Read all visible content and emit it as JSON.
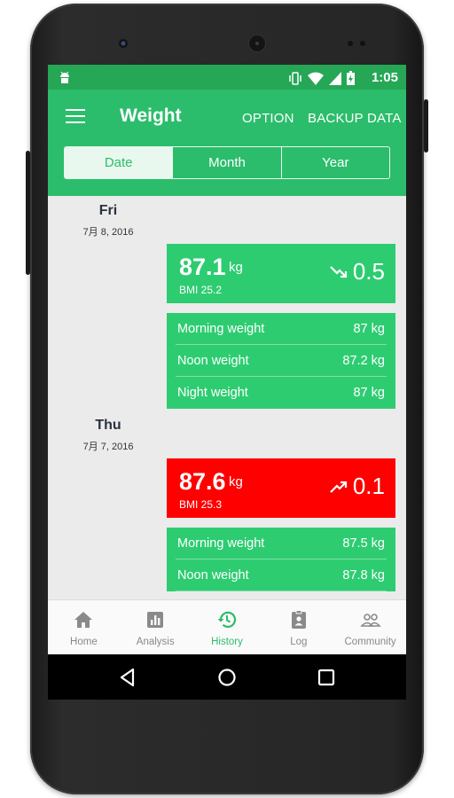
{
  "status_bar": {
    "time": "1:05"
  },
  "app_bar": {
    "title": "Weight",
    "option_label": "OPTION",
    "backup_label": "BACKUP DATA",
    "segments": [
      {
        "label": "Date",
        "active": true
      },
      {
        "label": "Month",
        "active": false
      },
      {
        "label": "Year",
        "active": false
      }
    ]
  },
  "days": [
    {
      "day": "Fri",
      "date": "7月 8, 2016",
      "weight": "87.1",
      "unit": "kg",
      "bmi": "BMI 25.2",
      "trend_icon": "trending-down-icon",
      "change": "0.5",
      "status_color": "#2ecc71",
      "readings": [
        {
          "label": "Morning weight",
          "value": "87 kg"
        },
        {
          "label": "Noon weight",
          "value": "87.2 kg"
        },
        {
          "label": "Night weight",
          "value": "87 kg"
        }
      ]
    },
    {
      "day": "Thu",
      "date": "7月 7, 2016",
      "weight": "87.6",
      "unit": "kg",
      "bmi": "BMI 25.3",
      "trend_icon": "trending-up-icon",
      "change": "0.1",
      "status_color": "#ff0000",
      "readings": [
        {
          "label": "Morning weight",
          "value": "87.5 kg"
        },
        {
          "label": "Noon weight",
          "value": "87.8 kg"
        }
      ]
    }
  ],
  "bottom_nav": [
    {
      "label": "Home",
      "icon": "home-icon",
      "active": false
    },
    {
      "label": "Analysis",
      "icon": "analysis-icon",
      "active": false
    },
    {
      "label": "History",
      "icon": "history-icon",
      "active": true
    },
    {
      "label": "Log",
      "icon": "log-icon",
      "active": false
    },
    {
      "label": "Community",
      "icon": "community-icon",
      "active": false
    }
  ],
  "colors": {
    "primary": "#2bbd6b",
    "status_bar": "#25a756",
    "card_green": "#2ecc71",
    "card_red": "#ff0000"
  }
}
